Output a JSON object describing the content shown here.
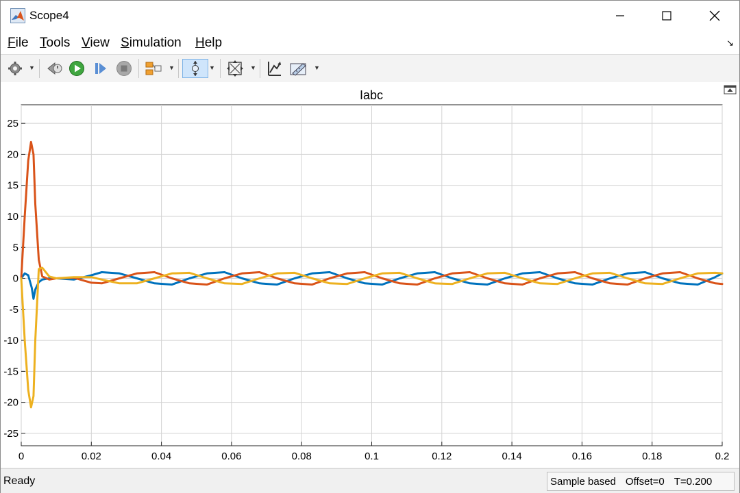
{
  "window": {
    "title": "Scope4"
  },
  "menu": {
    "items": [
      {
        "label": "File",
        "mnemonic": "F",
        "rest": "ile"
      },
      {
        "label": "Tools",
        "mnemonic": "T",
        "rest": "ools"
      },
      {
        "label": "View",
        "mnemonic": "V",
        "rest": "iew"
      },
      {
        "label": "Simulation",
        "mnemonic": "S",
        "rest": "imulation"
      },
      {
        "label": "Help",
        "mnemonic": "H",
        "rest": "elp"
      }
    ]
  },
  "toolbar": {
    "icons": [
      "gear-icon",
      "step-back-icon",
      "run-icon",
      "step-forward-icon",
      "stop-icon",
      "highlight-block-icon",
      "zoom-axes-icon",
      "fit-to-view-icon",
      "scale-axes-icon",
      "measurements-icon"
    ]
  },
  "status": {
    "state": "Ready",
    "mode": "Sample based",
    "offset": "Offset=0",
    "time": "T=0.200"
  },
  "colors": {
    "series_a": "#0072BD",
    "series_b": "#D95319",
    "series_c": "#EDB120"
  },
  "chart_data": {
    "type": "line",
    "title": "Iabc",
    "xlabel": "",
    "ylabel": "",
    "xlim": [
      0,
      0.2
    ],
    "ylim": [
      -27,
      28
    ],
    "xticks": [
      0,
      0.02,
      0.04,
      0.06,
      0.08,
      0.1,
      0.12,
      0.14,
      0.16,
      0.18,
      0.2
    ],
    "xtick_labels": [
      "0",
      "0.02",
      "0.04",
      "0.06",
      "0.08",
      "0.1",
      "0.12",
      "0.14",
      "0.16",
      "0.18",
      "0.2"
    ],
    "yticks": [
      25,
      20,
      15,
      10,
      5,
      0,
      -5,
      -10,
      -15,
      -20,
      -25
    ],
    "ytick_labels": [
      "25",
      "20",
      "15",
      "10",
      "5",
      "0",
      "-5",
      "-10",
      "-15",
      "-20",
      "-25"
    ],
    "grid": true,
    "series": [
      {
        "color": "#0072BD",
        "x": [
          0,
          0.001,
          0.002,
          0.003,
          0.0035,
          0.004,
          0.005,
          0.006,
          0.008,
          0.01,
          0.015,
          0.02,
          0.023,
          0.028,
          0.033,
          0.038,
          0.043,
          0.048,
          0.053,
          0.058,
          0.063,
          0.068,
          0.073,
          0.078,
          0.083,
          0.088,
          0.093,
          0.098,
          0.103,
          0.108,
          0.113,
          0.118,
          0.123,
          0.128,
          0.133,
          0.138,
          0.143,
          0.148,
          0.153,
          0.158,
          0.163,
          0.168,
          0.173,
          0.178,
          0.183,
          0.188,
          0.193,
          0.198,
          0.2
        ],
        "y": [
          0,
          0.8,
          0.5,
          -1.5,
          -3.3,
          -1.8,
          -0.6,
          -0.2,
          0,
          0,
          -0.2,
          0.5,
          1.0,
          0.8,
          0,
          -0.8,
          -1.0,
          0,
          0.8,
          1.0,
          0,
          -0.8,
          -1.0,
          0,
          0.8,
          1.0,
          0,
          -0.8,
          -1.0,
          0,
          0.8,
          1.0,
          0,
          -0.8,
          -1.0,
          0,
          0.8,
          1.0,
          0,
          -0.8,
          -1.0,
          0,
          0.8,
          1.0,
          0,
          -0.8,
          -1.0,
          0.2,
          0.8
        ]
      },
      {
        "color": "#D95319",
        "x": [
          0,
          0.001,
          0.002,
          0.0028,
          0.0035,
          0.004,
          0.005,
          0.006,
          0.008,
          0.01,
          0.015,
          0.02,
          0.023,
          0.028,
          0.033,
          0.038,
          0.043,
          0.048,
          0.053,
          0.058,
          0.063,
          0.068,
          0.073,
          0.078,
          0.083,
          0.088,
          0.093,
          0.098,
          0.103,
          0.108,
          0.113,
          0.118,
          0.123,
          0.128,
          0.133,
          0.138,
          0.143,
          0.148,
          0.153,
          0.158,
          0.163,
          0.168,
          0.173,
          0.178,
          0.183,
          0.188,
          0.193,
          0.198,
          0.2
        ],
        "y": [
          0,
          10,
          19,
          22,
          20,
          12,
          3,
          0.3,
          -0.2,
          0,
          0.1,
          -0.7,
          -0.8,
          0,
          0.8,
          1.0,
          0,
          -0.8,
          -1.0,
          0,
          0.8,
          1.0,
          0,
          -0.8,
          -1.0,
          0,
          0.8,
          1.0,
          0,
          -0.8,
          -1.0,
          0,
          0.8,
          1.0,
          0,
          -0.8,
          -1.0,
          0,
          0.8,
          1.0,
          0,
          -0.8,
          -1.0,
          0,
          0.8,
          1.0,
          0,
          -0.8,
          -0.9
        ]
      },
      {
        "color": "#EDB120",
        "x": [
          0,
          0.001,
          0.002,
          0.0028,
          0.0035,
          0.004,
          0.005,
          0.006,
          0.008,
          0.01,
          0.015,
          0.02,
          0.023,
          0.028,
          0.033,
          0.038,
          0.043,
          0.048,
          0.053,
          0.058,
          0.063,
          0.068,
          0.073,
          0.078,
          0.083,
          0.088,
          0.093,
          0.098,
          0.103,
          0.108,
          0.113,
          0.118,
          0.123,
          0.128,
          0.133,
          0.138,
          0.143,
          0.148,
          0.153,
          0.158,
          0.163,
          0.168,
          0.173,
          0.178,
          0.183,
          0.188,
          0.193,
          0.198,
          0.2
        ],
        "y": [
          0,
          -10,
          -18,
          -20.8,
          -19,
          -10,
          1.5,
          1.7,
          0.3,
          0,
          0.2,
          0.2,
          -0.2,
          -0.8,
          -0.8,
          0,
          0.8,
          0.9,
          0,
          -0.8,
          -0.9,
          0,
          0.8,
          0.9,
          0,
          -0.8,
          -0.9,
          0,
          0.8,
          0.9,
          0,
          -0.8,
          -0.9,
          0,
          0.8,
          0.9,
          0,
          -0.8,
          -0.9,
          0,
          0.8,
          0.9,
          0,
          -0.8,
          -0.9,
          0,
          0.8,
          0.9,
          0.8
        ]
      }
    ]
  }
}
